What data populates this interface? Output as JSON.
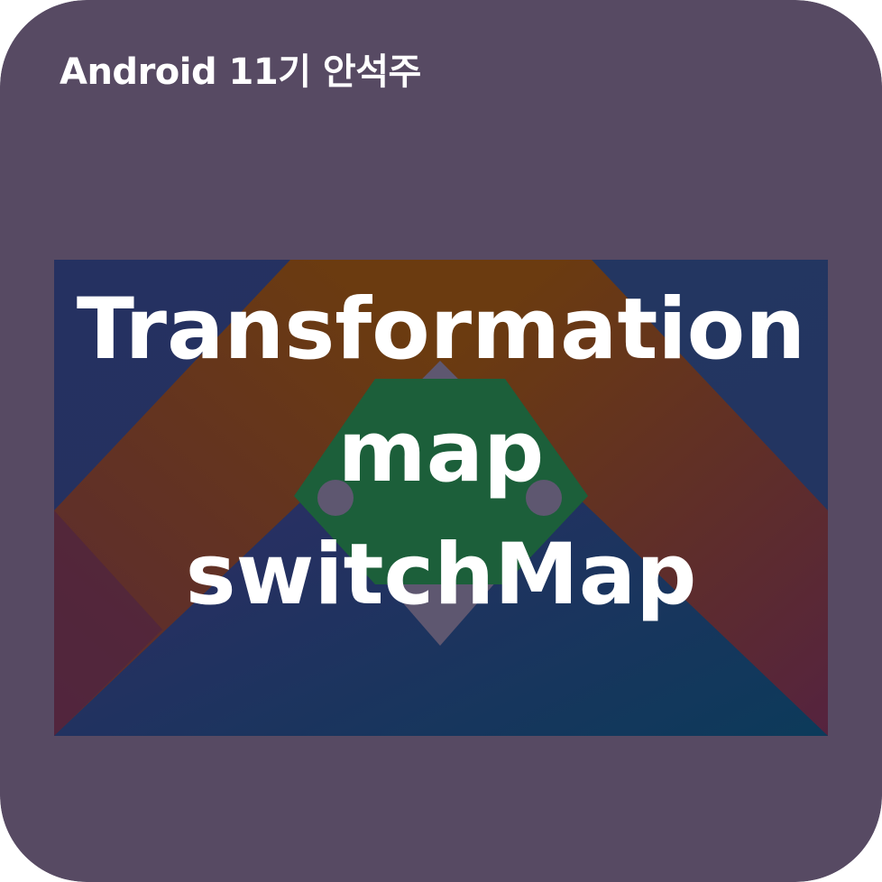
{
  "card": {
    "author_label": "Android 11기 안석주",
    "background_color": "#574a63"
  },
  "banner": {
    "title_lines": [
      "Transformation",
      "map",
      "switchMap"
    ],
    "image_icon": "android-jetpack-logo-icon",
    "colors": {
      "text": "#ffffff",
      "outer_blue": "#0a3d5c",
      "purple": "#3a2c6c",
      "brown": "#6b3b10",
      "maroon": "#5a2a33",
      "green": "#1c5f3a",
      "gray_diamond": "#5e5770"
    }
  }
}
